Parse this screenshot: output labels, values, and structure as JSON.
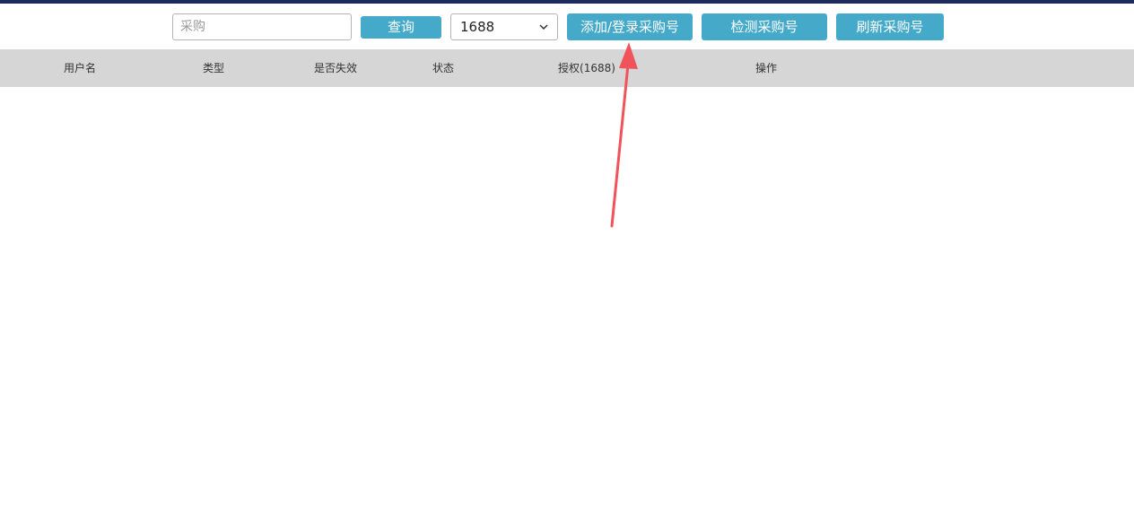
{
  "toolbar": {
    "search_placeholder": "采购",
    "search_value": "",
    "query_label": "查询",
    "platform_selected": "1688",
    "add_login_label": "添加/登录采购号",
    "check_label": "检测采购号",
    "refresh_label": "刷新采购号"
  },
  "table": {
    "columns": [
      "用户名",
      "类型",
      "是否失效",
      "状态",
      "授权(1688)",
      "操作"
    ],
    "rows": []
  },
  "colors": {
    "top_bar": "#1c2a5e",
    "button": "#45a9c9",
    "header_bg": "#d6d6d6",
    "annotation_arrow": "#f0535a"
  },
  "icons": {
    "select_chevron": "chevron-down-icon",
    "annotation": "red-arrow-annotation"
  }
}
